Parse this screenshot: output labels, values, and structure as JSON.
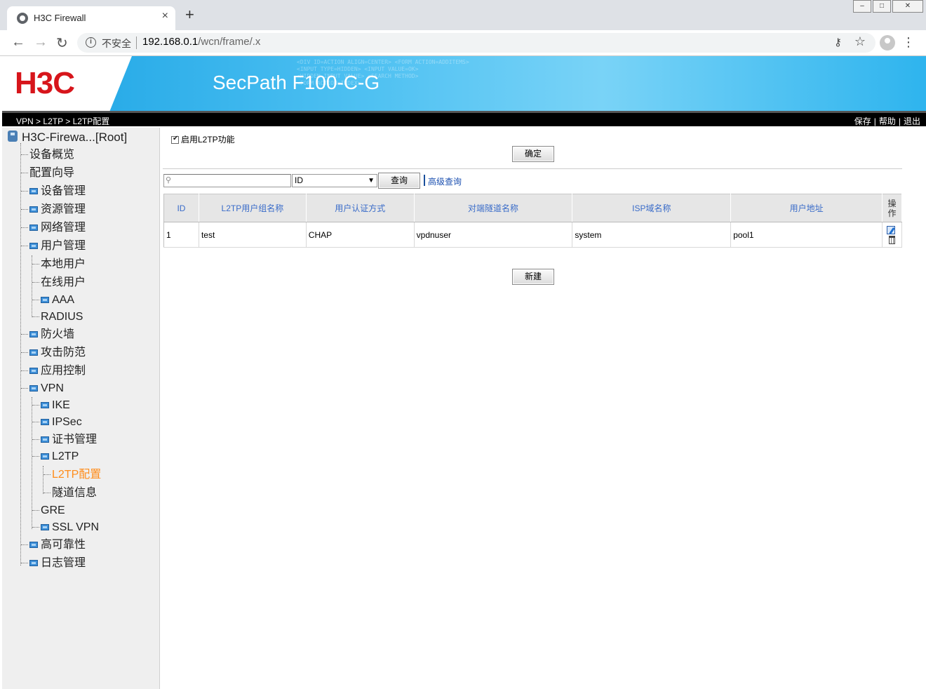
{
  "browser": {
    "tab_title": "H3C Firewall",
    "tab_close": "×",
    "new_tab": "+",
    "security_label": "不安全",
    "url_host": "192.168.0.1",
    "url_path": "/wcn/frame/.x",
    "back": "←",
    "forward": "→",
    "reload": "↻",
    "info": "i",
    "star": "☆",
    "key": "⚷",
    "menu": "⋮",
    "win_min": "–",
    "win_max": "□",
    "win_close": "✕"
  },
  "banner": {
    "logo": "H3C",
    "product": "SecPath F100-C-G"
  },
  "nav": {
    "crumb_1": "VPN",
    "crumb_2": "L2TP",
    "crumb_3": "L2TP配置",
    "crumb_sep": ">",
    "save": "保存",
    "help": "帮助",
    "logout": "退出",
    "sep": "|"
  },
  "tree": {
    "root": "H3C-Firewa...[Root]",
    "items": [
      {
        "label": "设备概览"
      },
      {
        "label": "配置向导"
      },
      {
        "label": "设备管理"
      },
      {
        "label": "资源管理"
      },
      {
        "label": "网络管理"
      },
      {
        "label": "用户管理"
      },
      {
        "label": "本地用户"
      },
      {
        "label": "在线用户"
      },
      {
        "label": "AAA"
      },
      {
        "label": "RADIUS"
      },
      {
        "label": "防火墙"
      },
      {
        "label": "攻击防范"
      },
      {
        "label": "应用控制"
      },
      {
        "label": "VPN"
      },
      {
        "label": "IKE"
      },
      {
        "label": "IPSec"
      },
      {
        "label": "证书管理"
      },
      {
        "label": "L2TP"
      },
      {
        "label": "L2TP配置"
      },
      {
        "label": "隧道信息"
      },
      {
        "label": "GRE"
      },
      {
        "label": "SSL VPN"
      },
      {
        "label": "高可靠性"
      },
      {
        "label": "日志管理"
      }
    ]
  },
  "l2tp": {
    "enable_label": "启用L2TP功能",
    "enable_checked": true,
    "confirm_button": "确定",
    "search_value": "",
    "search_field": "ID",
    "query_button": "查询",
    "advanced_link": "高级查询",
    "new_button": "新建",
    "columns": [
      "ID",
      "L2TP用户组名称",
      "用户认证方式",
      "对端隧道名称",
      "ISP域名称",
      "用户地址",
      "操作"
    ],
    "rows": [
      {
        "id": "1",
        "group": "test",
        "auth": "CHAP",
        "tunnel": "vpdnuser",
        "isp": "system",
        "address": "pool1"
      }
    ]
  },
  "colors": {
    "brand_red": "#d7151b",
    "banner_blue": "#1aa3e4",
    "link_blue": "#1a4fb0",
    "header_text": "#3a6cc9",
    "active_node": "#ff8c1a"
  }
}
